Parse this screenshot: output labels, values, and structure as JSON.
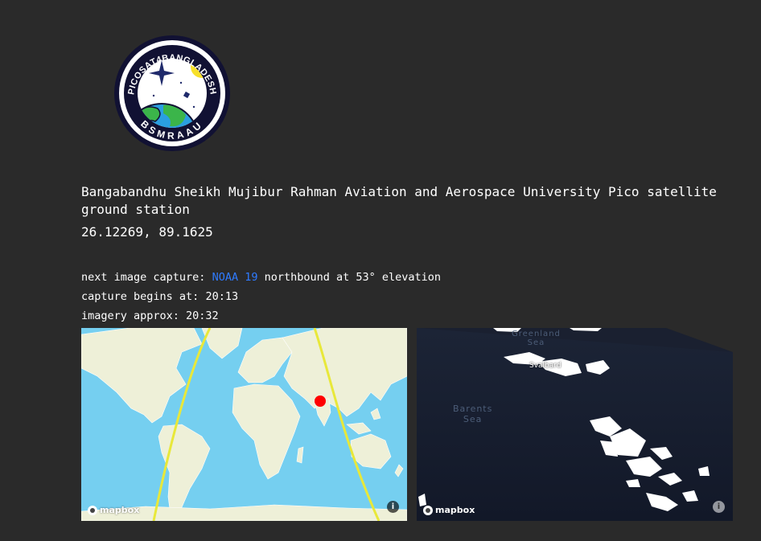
{
  "logo": {
    "top_text": "PICOSAT4BANGLADESH",
    "bottom_text": "BSMRAAU",
    "colors": {
      "ring": "#111133",
      "earth_water": "#2a9fe0",
      "earth_land": "#3bb54a",
      "sun": "#f7e02a",
      "star": "#1f2a6b"
    }
  },
  "station": {
    "title": "Bangabandhu Sheikh Mujibur Rahman Aviation and Aerospace University Pico satellite ground station",
    "coordinates": "26.12269, 89.1625"
  },
  "capture": {
    "next_label": "next image capture: ",
    "satellite": "NOAA 19",
    "direction_text": " northbound at 53° elevation",
    "begins_label": "capture begins at: ",
    "begins_time": "20:13",
    "imagery_label": "imagery approx: ",
    "imagery_time": "20:32"
  },
  "world_map": {
    "attribution": "mapbox",
    "info_icon": "info-icon",
    "colors": {
      "ocean": "#75cff0",
      "land": "#eef0d8",
      "track": "#e8e83a",
      "station_marker": "#ff0000"
    }
  },
  "satellite_map": {
    "attribution": "mapbox",
    "info_icon": "info-icon",
    "labels": {
      "greenland_sea": "Greenland\nSea",
      "svalbard": "Svalbard",
      "barents_sea": "Barents\nSea"
    }
  },
  "colors": {
    "background": "#2a2a2a",
    "link": "#2f7bff",
    "text": "#ffffff"
  }
}
